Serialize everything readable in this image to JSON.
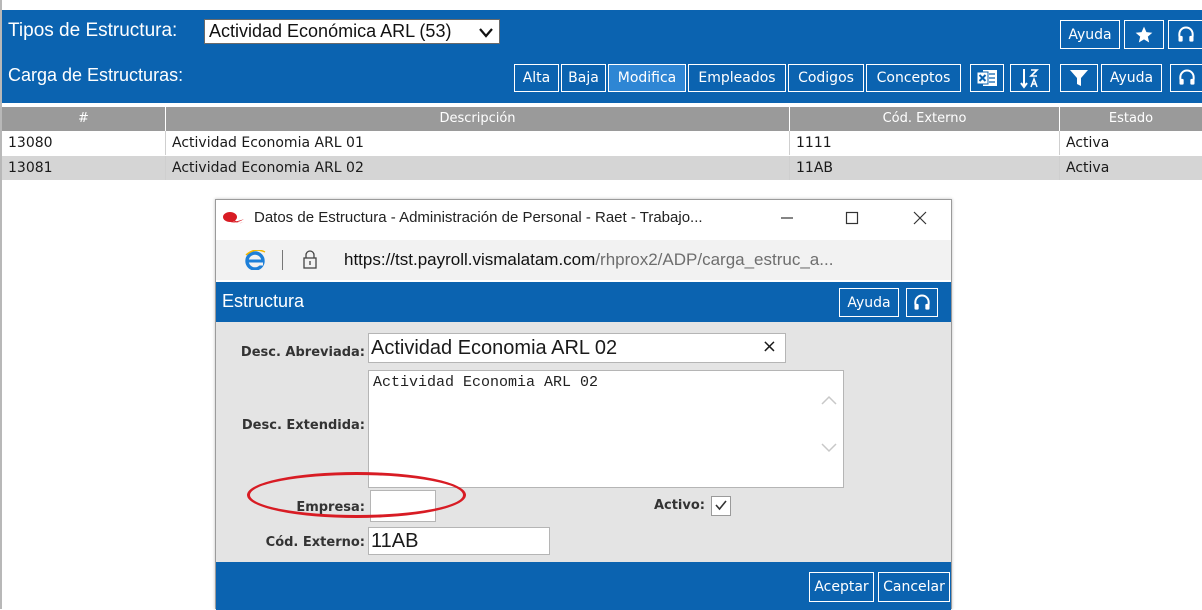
{
  "header": {
    "structure_type_label": "Tipos de Estructura:",
    "structure_type_value": "Actividad Económica ARL (53)",
    "help_label": "Ayuda",
    "subtitle": "Carga de Estructuras:",
    "actions": [
      "Alta",
      "Baja",
      "Modifica",
      "Empleados",
      "Codigos",
      "Conceptos"
    ],
    "selected_action": "Modifica",
    "help_label_2": "Ayuda"
  },
  "table": {
    "columns": [
      "#",
      "Descripción",
      "Cód. Externo",
      "Estado"
    ],
    "rows": [
      {
        "id": "13080",
        "desc": "Actividad Economia ARL 01",
        "code": "1111",
        "status": "Activa"
      },
      {
        "id": "13081",
        "desc": "Actividad Economia ARL 02",
        "code": "11AB",
        "status": "Activa"
      }
    ]
  },
  "popup": {
    "window_title": "Datos de Estructura - Administración de Personal - Raet - Trabajo...",
    "url_domain": "https://tst.payroll.vismalatam.com",
    "url_path": "/rhprox2/ADP/carga_estruc_a...",
    "section_title": "Estructura",
    "help_label": "Ayuda",
    "form": {
      "short_desc_label": "Desc. Abreviada:",
      "short_desc_value": "Actividad Economia ARL 02",
      "clear_symbol": "×",
      "long_desc_label": "Desc. Extendida:",
      "long_desc_value": "Actividad Economia ARL 02",
      "company_label": "Empresa:",
      "company_value": "",
      "active_label": "Activo:",
      "active_checked": true,
      "external_code_label": "Cód. Externo:",
      "external_code_value": "11AB"
    },
    "accept_label": "Aceptar",
    "cancel_label": "Cancelar"
  },
  "colors": {
    "brand_blue": "#0b63b0",
    "highlight_red": "#d81c24",
    "header_grey": "#9a9a9a"
  },
  "icons": [
    "star-icon",
    "headset-icon",
    "excel-icon",
    "sort-az-icon",
    "filter-icon",
    "visma-logo-icon",
    "ie-icon",
    "lock-icon",
    "minimize-icon",
    "maximize-icon",
    "close-icon",
    "chevron-down-icon",
    "check-icon"
  ]
}
